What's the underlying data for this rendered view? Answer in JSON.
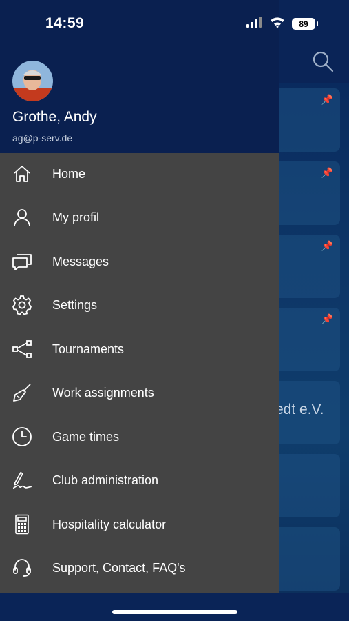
{
  "status_bar": {
    "time": "14:59",
    "battery": "89"
  },
  "user": {
    "name": "Grothe, Andy",
    "email": "ag@p-serv.de"
  },
  "menu": [
    {
      "label": "Home",
      "icon": "home-icon"
    },
    {
      "label": "My profil",
      "icon": "user-icon"
    },
    {
      "label": "Messages",
      "icon": "messages-icon"
    },
    {
      "label": "Settings",
      "icon": "gear-icon"
    },
    {
      "label": "Tournaments",
      "icon": "share-tree-icon"
    },
    {
      "label": "Work assignments",
      "icon": "broom-icon"
    },
    {
      "label": "Game times",
      "icon": "clock-icon"
    },
    {
      "label": "Club administration",
      "icon": "signature-pen-icon"
    },
    {
      "label": "Hospitality calculator",
      "icon": "calculator-icon"
    },
    {
      "label": "Support, Contact, FAQ's",
      "icon": "headset-icon"
    }
  ],
  "background": {
    "partial_text": "edt e.V."
  },
  "colors": {
    "drawer": "#444444",
    "header": "#0a2050",
    "pin": "#ff6a3d"
  }
}
